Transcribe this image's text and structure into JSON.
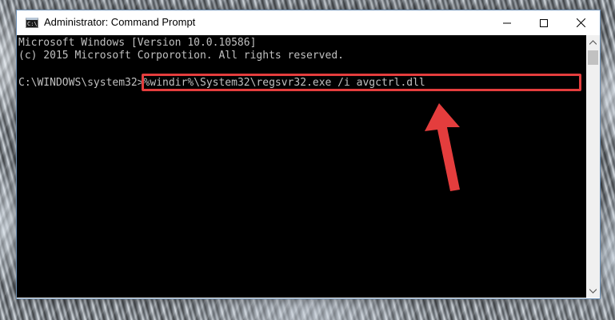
{
  "window": {
    "title": "Administrator: Command Prompt",
    "icon_label": "C:\\",
    "controls": {
      "minimize_icon": "minimize-icon",
      "maximize_icon": "maximize-icon",
      "close_icon": "close-icon"
    }
  },
  "console": {
    "lines": [
      "Microsoft Windows [Version 10.0.10586]",
      "(c) 2015 Microsoft Corporotion. All rights reserved."
    ],
    "prompt": "C:\\WINDOWS\\system32>",
    "command": "%windir%\\System32\\regsvr32.exe /i avgctrl.dll"
  },
  "annotation": {
    "highlight_color": "#e43d3d",
    "arrow_color": "#e43d3d"
  },
  "colors": {
    "console_background": "#000000",
    "console_text": "#c0c0c0",
    "titlebar_background": "#ffffff"
  }
}
